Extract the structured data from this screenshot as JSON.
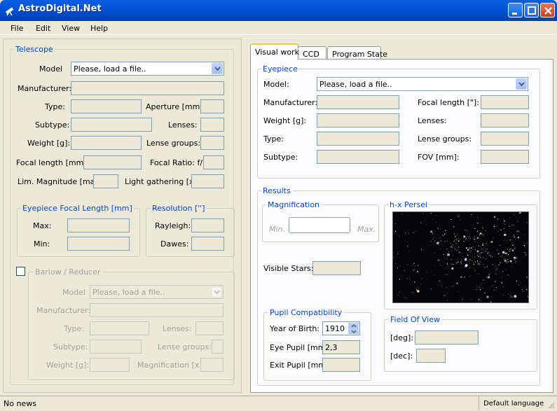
{
  "window": {
    "title": "AstroDigital.Net"
  },
  "menu": [
    "File",
    "Edit",
    "View",
    "Help"
  ],
  "telescope": {
    "title": "Telescope",
    "model_label": "Model",
    "model_value": "Please, load a file..",
    "manufacturer_label": "Manufacturer:",
    "type_label": "Type:",
    "aperture_label": "Aperture [mm]:",
    "subtype_label": "Subtype:",
    "lenses_label": "Lenses:",
    "weight_label": "Weight [g]:",
    "lense_groups_label": "Lense groups:",
    "focal_length_label": "Focal length [mm]:",
    "focal_ratio_label": "Focal Ratio:  f/",
    "lim_mag_label": "Lim. Magnitude [mag]:",
    "light_gathering_label": "Light gathering [x]:",
    "eyepiece_focal": {
      "title": "Eyepiece Focal Length [mm]",
      "max_label": "Max:",
      "min_label": "Min:"
    },
    "resolution": {
      "title": "Resolution ['']",
      "rayleigh_label": "Rayleigh:",
      "dawes_label": "Dawes:"
    }
  },
  "barlow": {
    "title": "Barlow / Reducer",
    "model_label": "Model",
    "model_value": "Please, load a file..",
    "manufacturer_label": "Manufacturer:",
    "type_label": "Type:",
    "lenses_label": "Lenses:",
    "subtype_label": "Subtype:",
    "lense_groups_label": "Lense groups:",
    "weight_label": "Weight [g]:",
    "magnification_label": "Magnification [x]:"
  },
  "tabs": [
    "Visual work",
    "CCD",
    "Program State"
  ],
  "eyepiece": {
    "title": "Eyepiece",
    "model_label": "Model:",
    "model_value": "Please, load a file..",
    "manufacturer_label": "Manufacturer:",
    "focal_length_label": "Focal length [\"]:",
    "weight_label": "Weight [g]:",
    "lenses_label": "Lenses:",
    "type_label": "Type:",
    "lense_groups_label": "Lense groups:",
    "subtype_label": "Subtype:",
    "fov_label": "FOV [mm]:"
  },
  "results": {
    "title": "Results",
    "magnification": {
      "title": "Magnification",
      "min_label": "Min.",
      "max_label": "Max."
    },
    "visible_stars_label": "Visible Stars:",
    "image_title": "h-x Persei",
    "pupil": {
      "title": "Pupil Compatibility",
      "year_label": "Year of Birth:",
      "year_value": "1910",
      "eye_pupil_label": "Eye Pupil [mm]:",
      "eye_pupil_value": "2,3",
      "exit_pupil_label": "Exit Pupil [mm]:"
    },
    "fov": {
      "title": "Field Of View",
      "deg_label": "[deg]:",
      "dec_label": "[dec]:"
    }
  },
  "status": {
    "left": "No news",
    "right": "Default language"
  }
}
